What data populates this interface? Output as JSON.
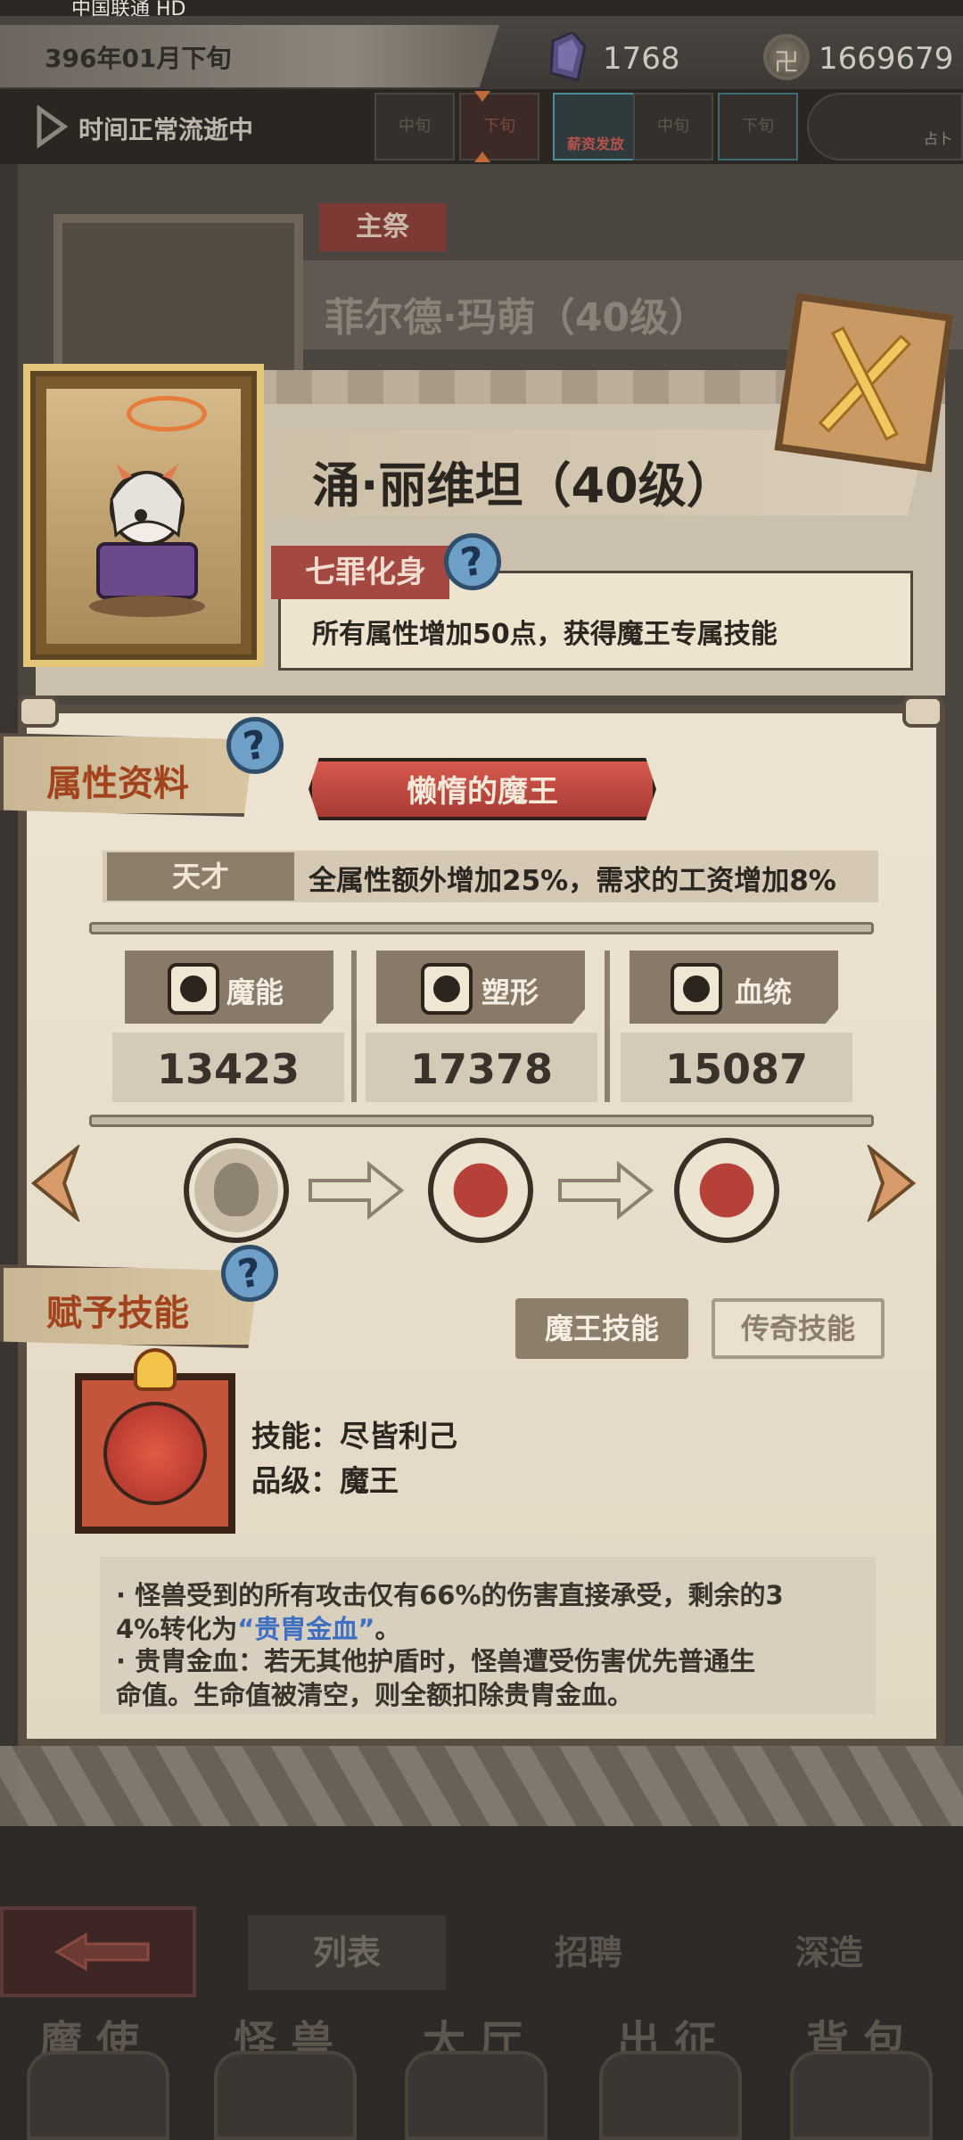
{
  "status_bar": {
    "carrier": "中国联通 HD"
  },
  "topbar": {
    "date": "396年01月下旬",
    "crystals": "1768",
    "coins": "1669679",
    "coin_glyph": "卍"
  },
  "timebar": {
    "status": "时间正常流逝中",
    "periods": [
      "中旬",
      "下旬",
      "薪资发放",
      "中旬",
      "下旬",
      "占卜"
    ]
  },
  "background_card": {
    "tag": "主祭",
    "name": "菲尔德·玛萌（40级）"
  },
  "popup": {
    "hero_name": "涌·丽维坦（40级）",
    "sin": {
      "tag": "七罪化身",
      "help": "?",
      "desc": "所有属性增加50点，获得魔王专属技能"
    },
    "attributes": {
      "section_label": "属性资料",
      "help": "?",
      "title": "懒惰的魔王",
      "talent_tag": "天才",
      "talent_desc": "全属性额外增加25%，需求的工资增加8%",
      "stats": [
        {
          "name": "魔能",
          "value": "13423",
          "icon": "magic-icon"
        },
        {
          "name": "塑形",
          "value": "17378",
          "icon": "body-icon"
        },
        {
          "name": "血统",
          "value": "15087",
          "icon": "bloodline-icon"
        }
      ]
    },
    "skills": {
      "section_label": "赋予技能",
      "help": "?",
      "btn_demon": "魔王技能",
      "btn_legend": "传奇技能",
      "name_line": "技能：尽皆利己",
      "grade_line": "品级：魔王",
      "desc": {
        "l1": "·   怪兽受到的所有攻击仅有66%的伤害直接承受，剩余的3",
        "l2a": "4%转化为",
        "l2b": "“贵胄金血”",
        "l2c": "。",
        "l3": "·   贵胄金血：若无其他护盾时，怪兽遭受伤害优先普通生",
        "l4": "命值。生命值被清空，则全额扣除贵胄金血。"
      }
    }
  },
  "bottom": {
    "subtabs": [
      "列表",
      "招聘",
      "深造"
    ],
    "nav": [
      "魔使",
      "怪兽",
      "大厅",
      "出征",
      "背包"
    ]
  },
  "colors": {
    "accent_red": "#a44842",
    "help_blue": "#6e9fc7",
    "highlight_blue": "#3f6fc2",
    "parchment": "#ece3d3"
  }
}
